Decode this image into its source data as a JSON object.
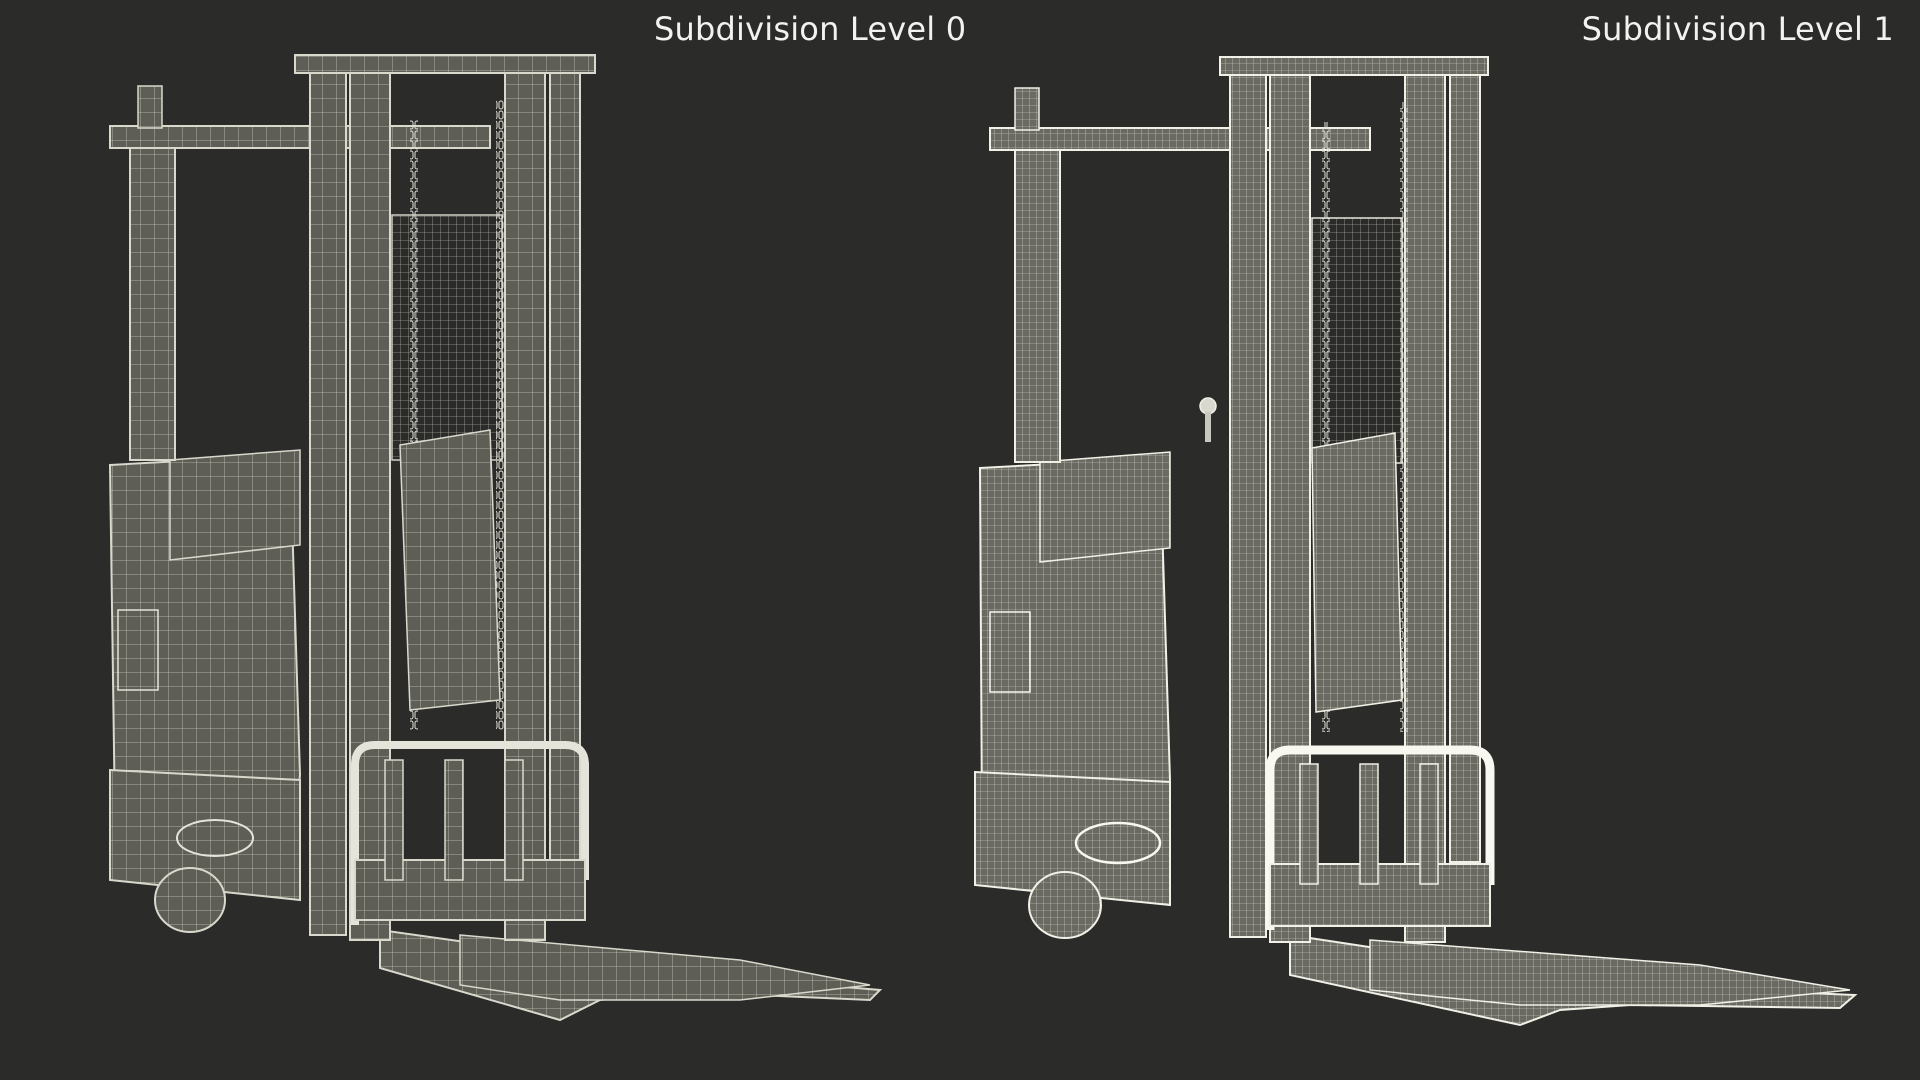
{
  "labels": {
    "left": "Subdivision Level 0",
    "right": "Subdivision Level 1"
  },
  "colors": {
    "background": "#2b2b2a",
    "wire_level0": "#d8d8cc",
    "wire_level1": "#f0f0e6",
    "surface": "#5e5e56",
    "label_text": "#f2f2ee"
  }
}
